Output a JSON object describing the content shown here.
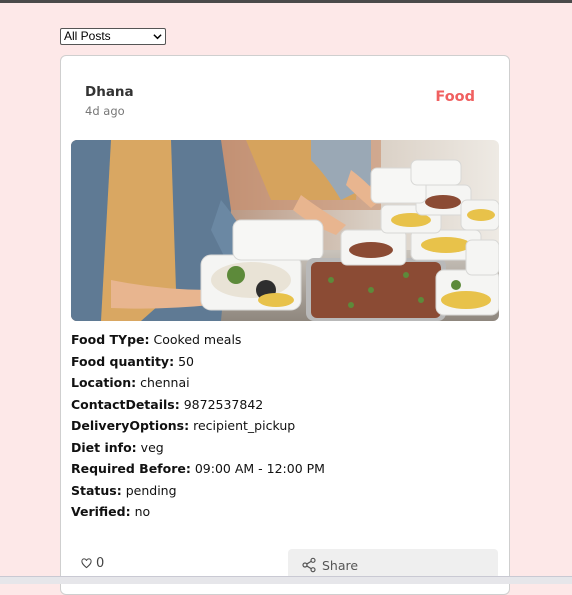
{
  "filter": {
    "selected": "All Posts"
  },
  "post": {
    "author": "Dhana",
    "time": "4d ago",
    "category": "Food",
    "fields": [
      {
        "label": "Food TYpe:",
        "value": "Cooked meals"
      },
      {
        "label": "Food quantity:",
        "value": "50"
      },
      {
        "label": "Location:",
        "value": "chennai"
      },
      {
        "label": "ContactDetails:",
        "value": "9872537842"
      },
      {
        "label": "DeliveryOptions:",
        "value": "recipient_pickup"
      },
      {
        "label": "Diet info:",
        "value": "veg"
      },
      {
        "label": "Required Before:",
        "value": "09:00 AM - 12:00 PM"
      },
      {
        "label": "Status:",
        "value": "pending"
      },
      {
        "label": "Verified:",
        "value": "no"
      }
    ],
    "likes": "0",
    "share_label": "Share"
  },
  "colors": {
    "page_bg": "#fde8e8",
    "category": "#f06060"
  },
  "icons": {
    "like": "heart-outline-icon",
    "share": "share-icon",
    "dropdown": "chevron-down-icon"
  }
}
